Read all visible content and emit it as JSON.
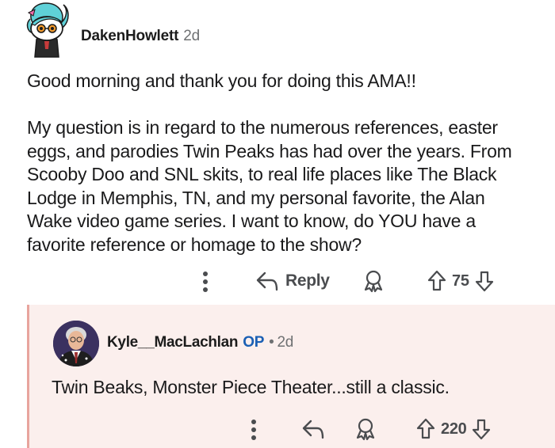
{
  "parent_comment": {
    "username": "DakenHowlett",
    "age": "2d",
    "paragraphs": [
      "Good morning and thank you for doing this AMA!!",
      "My question is in regard to the numerous references, easter eggs, and parodies Twin Peaks has had over the years. From Scooby Doo and SNL skits, to real life places like The Black Lodge in Memphis, TN, and my personal favorite, the Alan Wake video game series. I want to know, do YOU have a favorite reference or homage to the show?"
    ],
    "actions": {
      "more_icon": "vertical-ellipsis-icon",
      "reply_icon": "reply-arrow-icon",
      "reply_label": "Reply",
      "award_icon": "award-icon",
      "upvote_icon": "upvote-arrow-icon",
      "vote_count": "75",
      "downvote_icon": "downvote-arrow-icon"
    }
  },
  "reply_comment": {
    "username": "Kyle__MacLachlan",
    "op_badge": "OP",
    "separator": "•",
    "age": "2d",
    "body": "Twin Beaks, Monster Piece Theater...still a classic.",
    "actions": {
      "more_icon": "vertical-ellipsis-icon",
      "reply_icon": "reply-arrow-icon",
      "award_icon": "award-icon",
      "upvote_icon": "upvote-arrow-icon",
      "vote_count": "220",
      "downvote_icon": "downvote-arrow-icon"
    }
  },
  "colors": {
    "reply_background": "#fbefed",
    "reply_thread_line": "#e8a49d",
    "op_badge": "#1a5fb4",
    "meta_gray": "#6f7173",
    "action_gray": "#4a4c4f"
  }
}
